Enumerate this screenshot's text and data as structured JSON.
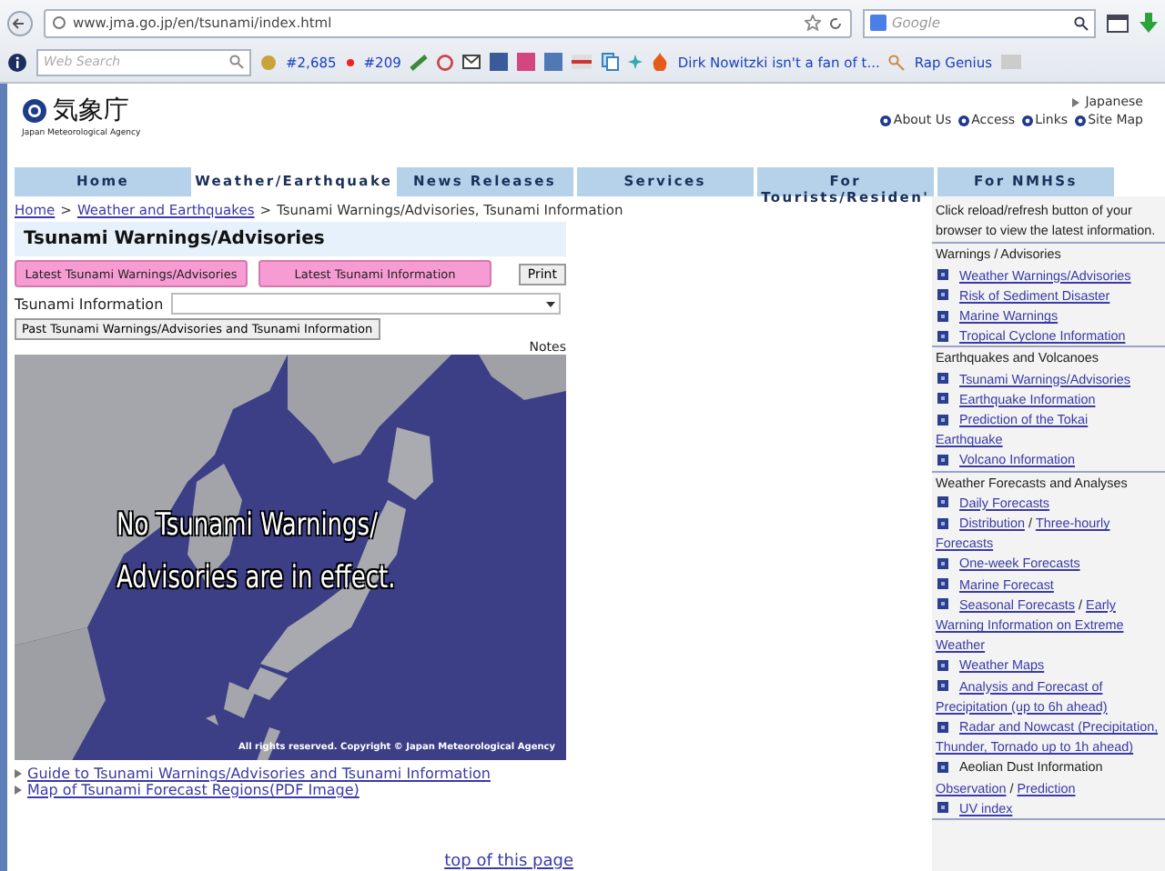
{
  "browser": {
    "url": "www.jma.go.jp/en/tsunami/index.html",
    "search_placeholder": "Google",
    "toolbar": {
      "web_search_placeholder": "Web Search",
      "count_1": "#2,685",
      "count_2": "#209",
      "news": "Dirk Nowitzki isn't a fan of t...",
      "site": "Rap Genius"
    }
  },
  "header": {
    "logo_text": "気象庁",
    "logo_subtitle": "Japan Meteorological Agency",
    "language_link": "Japanese",
    "links": [
      "About Us",
      "Access",
      "Links",
      "Site Map"
    ]
  },
  "nav": [
    {
      "label": "Home",
      "selected": false
    },
    {
      "label": "Weather/Earthquake",
      "selected": true
    },
    {
      "label": "News Releases",
      "selected": false
    },
    {
      "label": "Services",
      "selected": false
    },
    {
      "label": "For Tourists/Residen'",
      "selected": false
    },
    {
      "label": "For NMHSs",
      "selected": false
    }
  ],
  "breadcrumb": {
    "links": [
      "Home",
      "Weather and Earthquakes"
    ],
    "separators": [
      ">",
      ">"
    ],
    "current": "Tsunami Warnings/Advisories, Tsunami Information"
  },
  "main": {
    "title": "Tsunami Warnings/Advisories",
    "tabs": [
      "Latest Tsunami Warnings/Advisories",
      "Latest Tsunami Information"
    ],
    "print": "Print",
    "select_label": "Tsunami Information",
    "past_button": "Past Tsunami Warnings/Advisories and Tsunami Information",
    "notes": "Notes",
    "map": {
      "kind": "picture",
      "message": [
        "No Tsunami Warnings/",
        "Advisories are in effect."
      ],
      "copyright": "All rights reserved. Copyright © Japan Meteorological Agency"
    },
    "links": [
      "Guide to Tsunami Warnings/Advisories and Tsunami Information",
      "Map of Tsunami Forecast Regions(PDF Image)"
    ],
    "top_link": "top of this page"
  },
  "sidebar": {
    "notice": "Click reload/refresh button of your browser to view the latest information.",
    "sections": [
      {
        "header": "Warnings / Advisories",
        "items": [
          {
            "bullet": true,
            "lines": [
              [
                {
                  "text": "Weather Warnings/Advisories",
                  "link": true
                }
              ]
            ]
          },
          {
            "bullet": true,
            "lines": [
              [
                {
                  "text": "Risk of Sediment Disaster",
                  "link": true
                }
              ]
            ]
          },
          {
            "bullet": true,
            "lines": [
              [
                {
                  "text": "Marine Warnings",
                  "link": true
                }
              ]
            ]
          },
          {
            "bullet": true,
            "lines": [
              [
                {
                  "text": "Tropical Cyclone Information",
                  "link": true
                }
              ]
            ]
          }
        ]
      },
      {
        "header": "Earthquakes and Volcanoes",
        "items": [
          {
            "bullet": true,
            "lines": [
              [
                {
                  "text": "Tsunami Warnings/Advisories",
                  "link": true
                }
              ]
            ]
          },
          {
            "bullet": true,
            "lines": [
              [
                {
                  "text": "Earthquake Information",
                  "link": true
                }
              ]
            ]
          },
          {
            "bullet": true,
            "lines": [
              [
                {
                  "text": "Prediction of the Tokai",
                  "link": true
                }
              ],
              [
                {
                  "text": "Earthquake",
                  "link": true
                }
              ]
            ]
          },
          {
            "bullet": true,
            "lines": [
              [
                {
                  "text": "Volcano Information",
                  "link": true
                }
              ]
            ]
          }
        ]
      },
      {
        "header": "Weather Forecasts and Analyses",
        "items": [
          {
            "bullet": true,
            "lines": [
              [
                {
                  "text": "Daily Forecasts",
                  "link": true
                }
              ]
            ]
          },
          {
            "bullet": true,
            "lines": [
              [
                {
                  "text": "Distribution",
                  "link": true
                },
                {
                  "text": "/",
                  "link": false
                },
                {
                  "text": "Three-hourly",
                  "link": true
                }
              ],
              [
                {
                  "text": "Forecasts",
                  "link": true
                }
              ]
            ]
          },
          {
            "bullet": true,
            "lines": [
              [
                {
                  "text": "One-week Forecasts",
                  "link": true
                }
              ]
            ]
          },
          {
            "bullet": true,
            "lines": [
              [
                {
                  "text": "Marine Forecast",
                  "link": true
                }
              ]
            ]
          },
          {
            "bullet": true,
            "lines": [
              [
                {
                  "text": "Seasonal Forecasts",
                  "link": true
                },
                {
                  "text": "/",
                  "link": false
                },
                {
                  "text": "Early",
                  "link": true
                }
              ],
              [
                {
                  "text": "Warning Information on Extreme",
                  "link": true
                }
              ],
              [
                {
                  "text": "Weather",
                  "link": true
                }
              ]
            ]
          },
          {
            "bullet": true,
            "lines": [
              [
                {
                  "text": "Weather Maps",
                  "link": true
                }
              ]
            ]
          },
          {
            "bullet": true,
            "lines": [
              [
                {
                  "text": "Analysis and Forecast of",
                  "link": true
                }
              ],
              [
                {
                  "text": "Precipitation (up to 6h ahead)",
                  "link": true
                }
              ]
            ]
          },
          {
            "bullet": true,
            "lines": [
              [
                {
                  "text": "Radar and Nowcast (Precipitation,",
                  "link": true
                }
              ],
              [
                {
                  "text": "Thunder, Tornado up to 1h ahead)",
                  "link": true
                }
              ]
            ]
          },
          {
            "bullet": true,
            "lines": [
              [
                {
                  "text": "Aeolian Dust Information",
                  "link": false
                }
              ]
            ]
          },
          {
            "bullet": false,
            "lines": [
              [
                {
                  "text": "Observation",
                  "link": true
                },
                {
                  "text": "/",
                  "link": false
                },
                {
                  "text": "Prediction",
                  "link": true
                }
              ]
            ]
          },
          {
            "bullet": true,
            "lines": [
              [
                {
                  "text": "UV index",
                  "link": true
                }
              ]
            ]
          }
        ]
      }
    ]
  }
}
